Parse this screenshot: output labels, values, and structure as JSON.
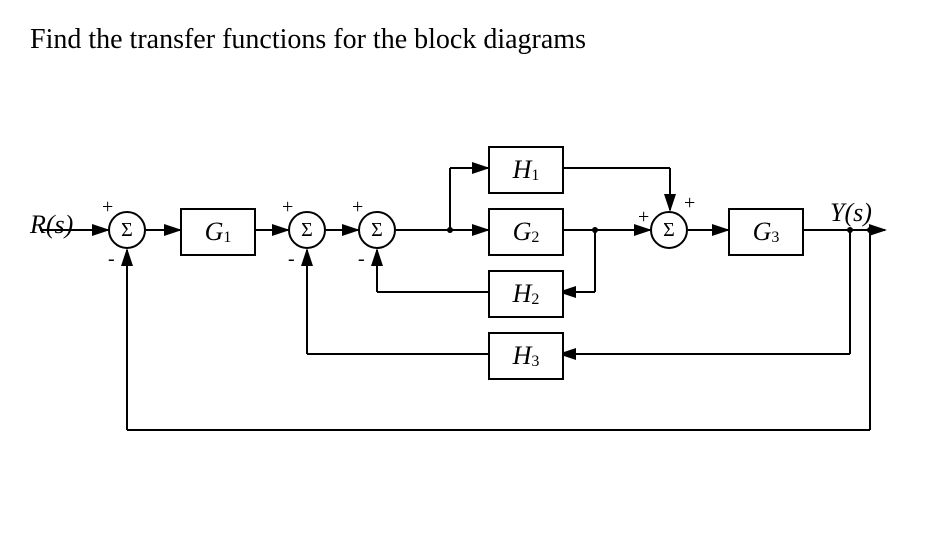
{
  "title": "Find the transfer functions for the block diagrams",
  "input_label": "R(s)",
  "output_label": "Y(s)",
  "sum_symbol": "Σ",
  "blocks": {
    "G1": "G",
    "G1_sub": "1",
    "G2": "G",
    "G2_sub": "2",
    "G3": "G",
    "G3_sub": "3",
    "H1": "H",
    "H1_sub": "1",
    "H2": "H",
    "H2_sub": "2",
    "H3": "H",
    "H3_sub": "3"
  },
  "signs": {
    "s1_top": "+",
    "s1_bot": "-",
    "s2_top": "+",
    "s2_bot": "-",
    "s3_top": "+",
    "s3_bot": "-",
    "s4_top": "+",
    "s4_right": "+"
  },
  "chart_data": {
    "type": "block_diagram",
    "nodes": [
      {
        "id": "R",
        "type": "input",
        "label": "R(s)"
      },
      {
        "id": "S1",
        "type": "sum",
        "inputs": [
          {
            "from": "R",
            "sign": "+"
          },
          {
            "from": "Y",
            "sign": "-"
          }
        ]
      },
      {
        "id": "G1",
        "type": "block",
        "label": "G1"
      },
      {
        "id": "S2",
        "type": "sum",
        "inputs": [
          {
            "from": "G1",
            "sign": "+"
          },
          {
            "from": "H3",
            "sign": "-"
          }
        ]
      },
      {
        "id": "S3",
        "type": "sum",
        "inputs": [
          {
            "from": "S2",
            "sign": "+"
          },
          {
            "from": "H2",
            "sign": "-"
          }
        ]
      },
      {
        "id": "H1",
        "type": "block",
        "label": "H1",
        "input_from": "S3"
      },
      {
        "id": "G2",
        "type": "block",
        "label": "G2",
        "input_from": "S3"
      },
      {
        "id": "S4",
        "type": "sum",
        "inputs": [
          {
            "from": "G2",
            "sign": "+"
          },
          {
            "from": "H1",
            "sign": "+"
          }
        ]
      },
      {
        "id": "G3",
        "type": "block",
        "label": "G3",
        "input_from": "S4"
      },
      {
        "id": "Y",
        "type": "output",
        "label": "Y(s)",
        "from": "G3"
      },
      {
        "id": "H2",
        "type": "block",
        "label": "H2",
        "input_from": "G2"
      },
      {
        "id": "H3",
        "type": "block",
        "label": "H3",
        "input_from": "Y"
      }
    ]
  }
}
